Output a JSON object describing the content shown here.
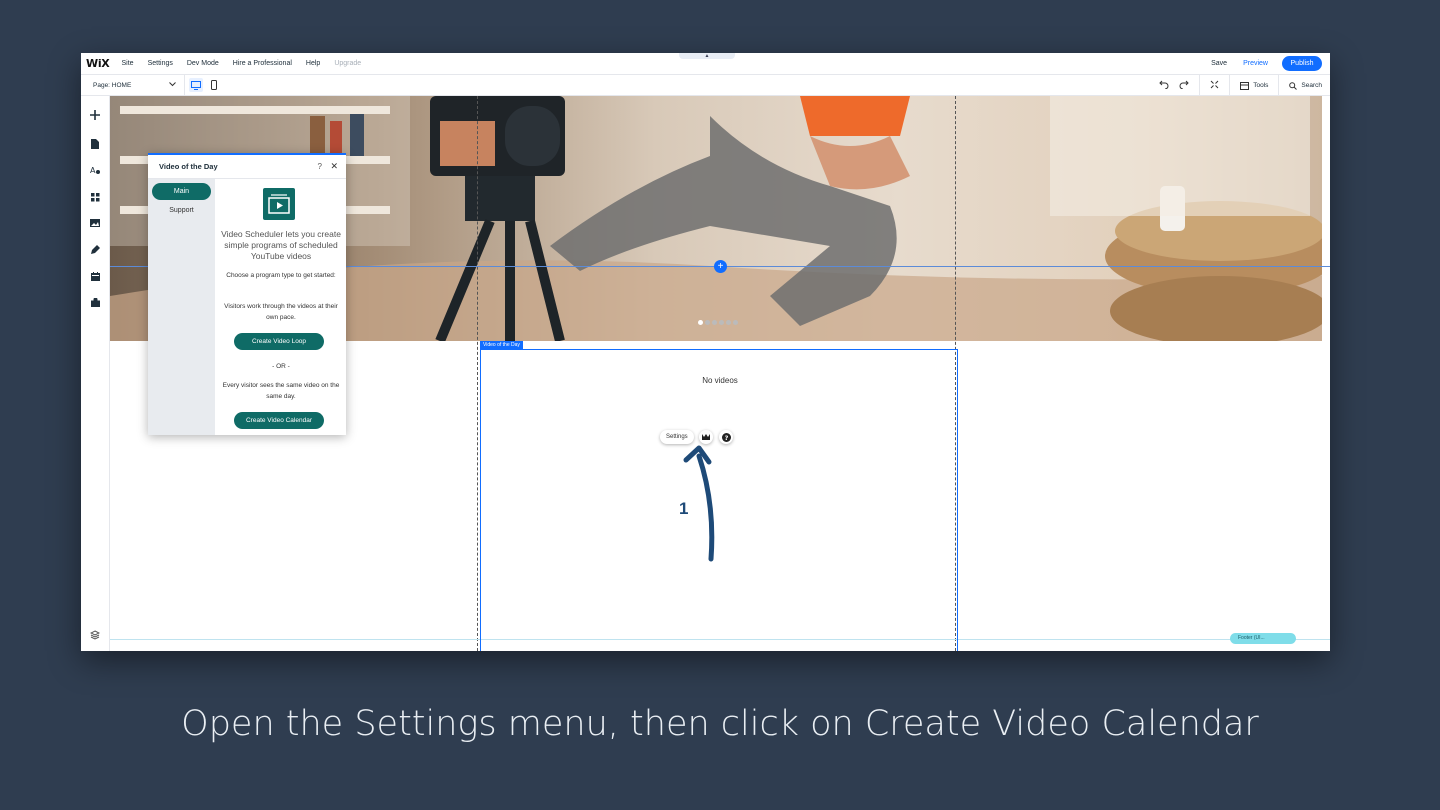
{
  "topbar": {
    "logo": "WiX",
    "menu": [
      "Site",
      "Settings",
      "Dev Mode",
      "Hire a Professional",
      "Help",
      "Upgrade"
    ],
    "save": "Save",
    "preview": "Preview",
    "publish": "Publish",
    "collapse": "▲"
  },
  "subbar": {
    "page": "Page: HOME",
    "tools": "Tools",
    "search": "Search"
  },
  "widget": {
    "tag": "Video of the Day",
    "empty_text": "No videos",
    "settings": "Settings",
    "step": "1"
  },
  "footer_chip": "Footer (UI...",
  "panel": {
    "title": "Video of the Day",
    "help": "?",
    "close": "✕",
    "tab_main": "Main",
    "tab_support": "Support",
    "lead": "Video Scheduler lets you create simple programs of scheduled YouTube videos",
    "choose": "Choose a program type to get started:",
    "loop_desc": "Visitors work through the videos at their own pace.",
    "loop_btn": "Create Video Loop",
    "or": "- OR -",
    "cal_desc": "Every visitor sees the same video on the same day.",
    "cal_btn": "Create Video Calendar"
  },
  "caption": "Open the Settings menu, then click on Create Video Calendar",
  "colors": {
    "background": "#2f3d50",
    "accent": "#116dff",
    "teal": "#0f6b66",
    "arrow": "#1e4a78"
  }
}
